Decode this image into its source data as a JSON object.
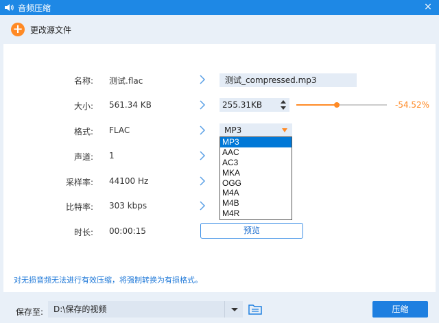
{
  "window": {
    "title": "音频压缩",
    "close_glyph": "×"
  },
  "toolbar": {
    "change_source_label": "更改源文件",
    "add_glyph": "+"
  },
  "fields": {
    "name": {
      "label": "名称:",
      "value": "测试.flac",
      "output": "测试_compressed.mp3"
    },
    "size": {
      "label": "大小:",
      "value": "561.34 KB",
      "output": "255.31KB",
      "percent_text": "-54.52%",
      "ratio": 0.45
    },
    "format": {
      "label": "格式:",
      "value": "FLAC",
      "selected": "MP3",
      "options": [
        "MP3",
        "AAC",
        "AC3",
        "MKA",
        "OGG",
        "M4A",
        "M4B",
        "M4R"
      ]
    },
    "channel": {
      "label": "声道:",
      "value": "1"
    },
    "sample_rate": {
      "label": "采样率:",
      "value": "44100 Hz"
    },
    "bitrate": {
      "label": "比特率:",
      "value": "303 kbps"
    },
    "duration": {
      "label": "时长:",
      "value": "00:00:15"
    }
  },
  "preview_label": "预览",
  "notice": "对无损音频无法进行有效压缩，将强制转换为有损格式。",
  "bottom": {
    "save_label": "保存至:",
    "path": "D:\\保存的视频",
    "compress_label": "压缩"
  },
  "colors": {
    "accent": "#ff8a25",
    "primary": "#1e7fe0",
    "title_bar": "#1e88e5"
  },
  "icons": {
    "app": "speaker-icon",
    "close": "close-icon",
    "add": "add-icon",
    "arrow": "chevron-right-icon",
    "folder": "folder-icon",
    "stepper": "up-down-stepper-icon"
  }
}
